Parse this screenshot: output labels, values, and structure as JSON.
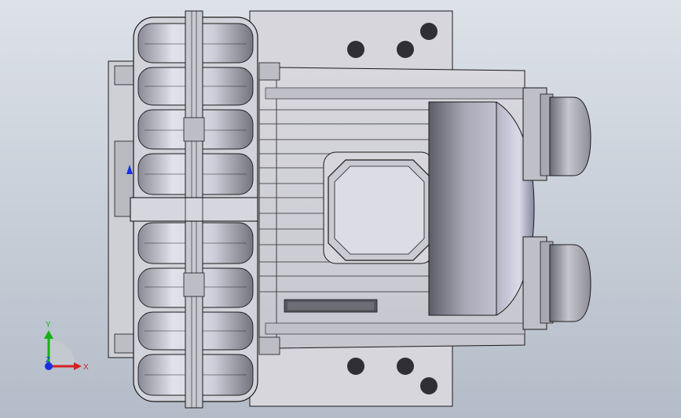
{
  "viewport": {
    "background_top": "#dde2e9",
    "background_bottom": "#b3bcc8"
  },
  "model": {
    "part_fill": "#d4d4da",
    "edge_color": "#1a1a1a",
    "shade_dark": "#6e6e78",
    "shade_mid": "#b9b9c3",
    "shade_light": "#f0f0f6",
    "hole_color": "#2f2f35"
  },
  "triad": {
    "x_label": "X",
    "y_label": "Y",
    "z_label": "Z",
    "x_color": "#d62020",
    "y_color": "#18b018",
    "z_color": "#1a2fe0"
  }
}
